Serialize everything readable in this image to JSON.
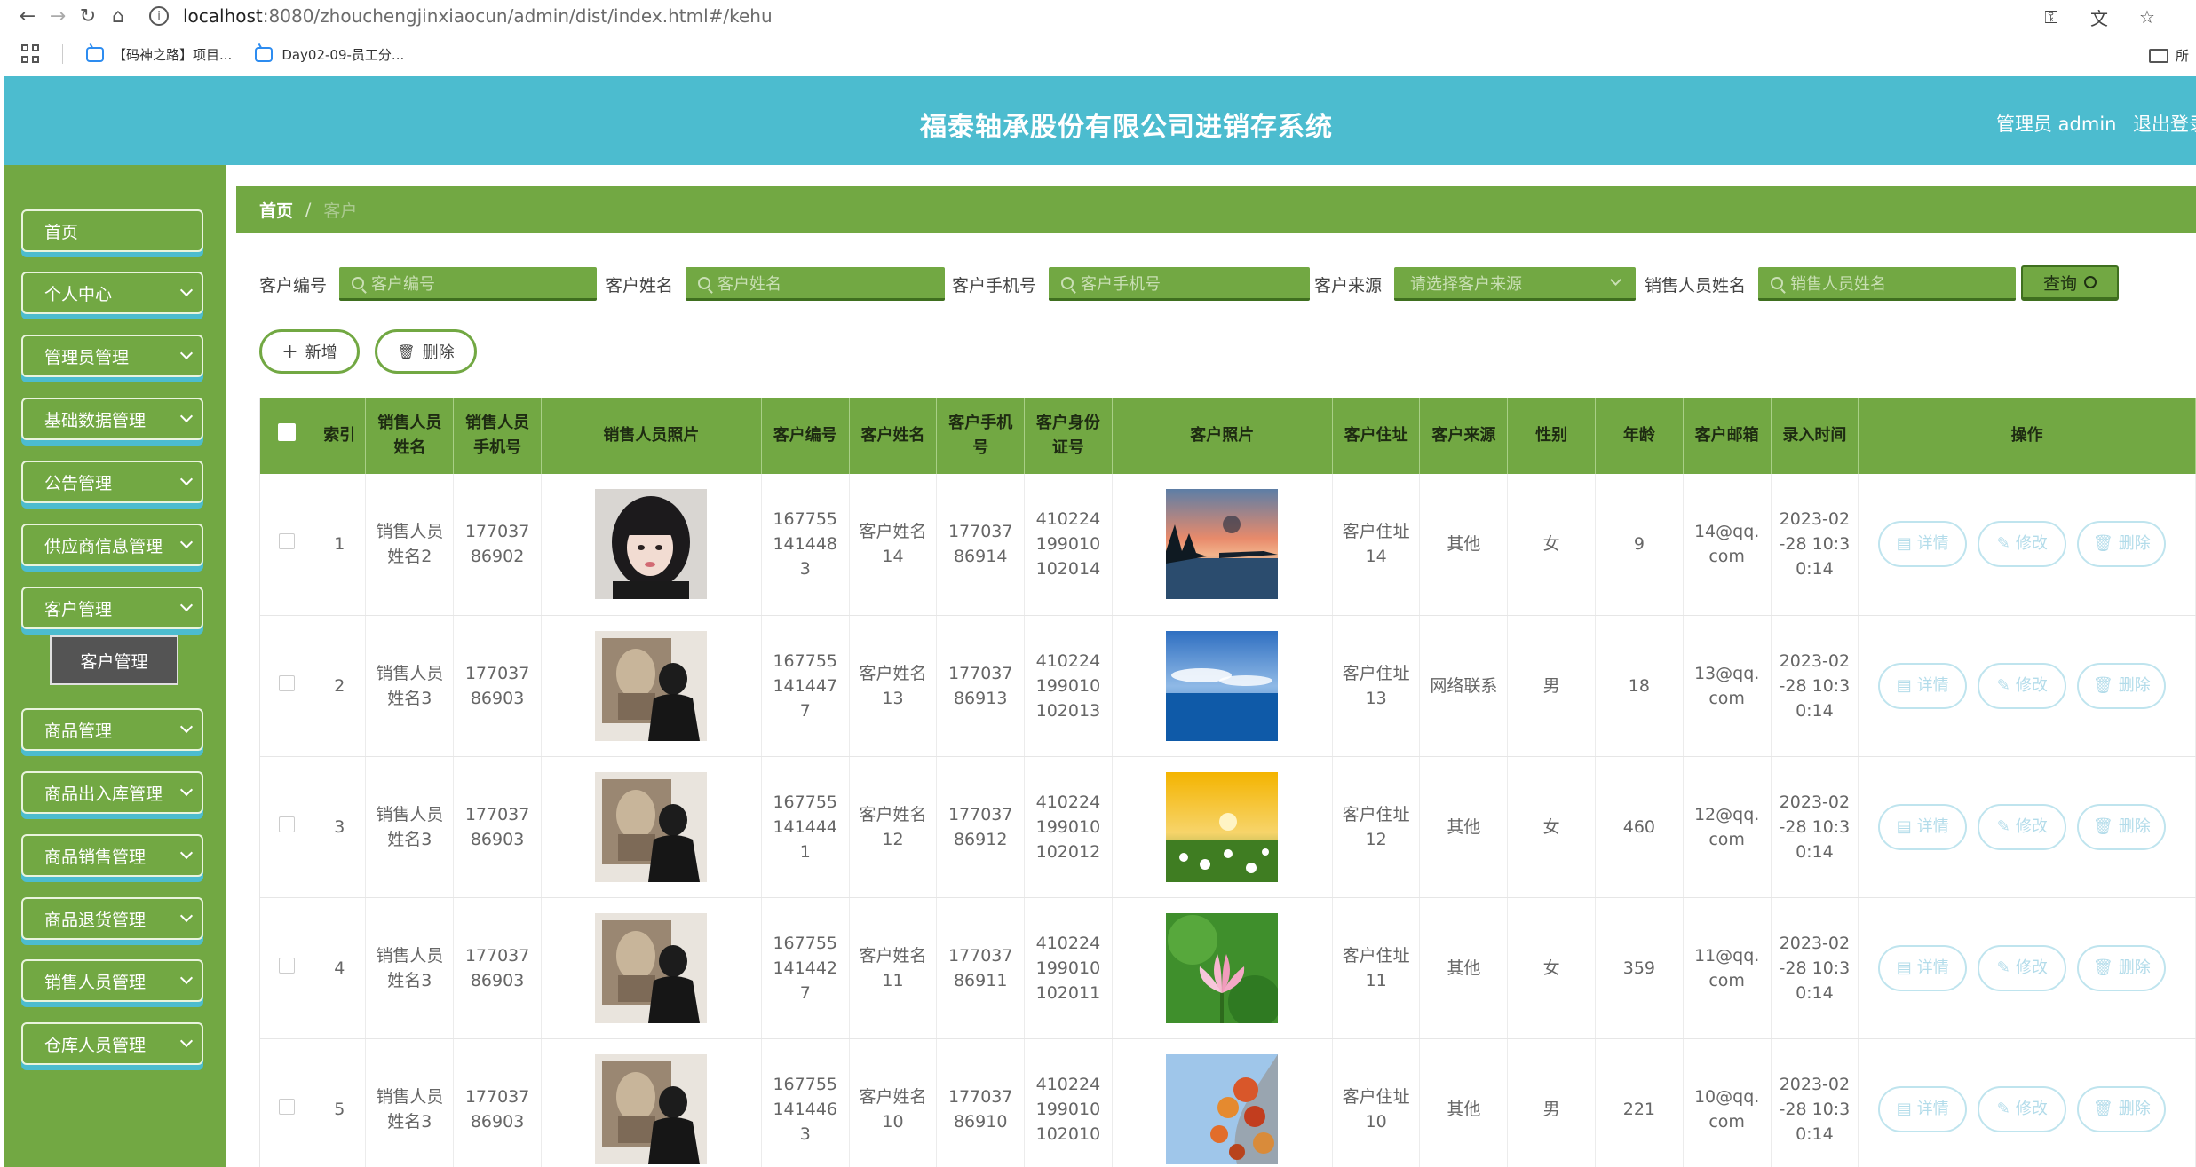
{
  "browser": {
    "host": "localhost",
    "url_path": ":8080/zhouchengjinxiaocun/admin/dist/index.html#/kehu",
    "bookmarks": [
      "【码神之路】项目...",
      "Day02-09-员工分..."
    ],
    "bookmarks_right": "所"
  },
  "header": {
    "title": "福泰轴承股份有限公司进销存系统",
    "user": "管理员 admin",
    "logout": "退出登录"
  },
  "sidebar": {
    "items": [
      {
        "label": "首页",
        "has_children": false
      },
      {
        "label": "个人中心",
        "has_children": true
      },
      {
        "label": "管理员管理",
        "has_children": true
      },
      {
        "label": "基础数据管理",
        "has_children": true
      },
      {
        "label": "公告管理",
        "has_children": true
      },
      {
        "label": "供应商信息管理",
        "has_children": true
      },
      {
        "label": "客户管理",
        "has_children": true
      },
      {
        "label": "商品管理",
        "has_children": true
      },
      {
        "label": "商品出入库管理",
        "has_children": true
      },
      {
        "label": "商品销售管理",
        "has_children": true
      },
      {
        "label": "商品退货管理",
        "has_children": true
      },
      {
        "label": "销售人员管理",
        "has_children": true
      },
      {
        "label": "仓库人员管理",
        "has_children": true
      }
    ],
    "active_sub": "客户管理"
  },
  "breadcrumb": {
    "home": "首页",
    "sep": "/",
    "current": "客户"
  },
  "filters": {
    "code_label": "客户编号",
    "code_placeholder": "客户编号",
    "name_label": "客户姓名",
    "name_placeholder": "客户姓名",
    "phone_label": "客户手机号",
    "phone_placeholder": "客户手机号",
    "source_label": "客户来源",
    "source_placeholder": "请选择客户来源",
    "sales_label": "销售人员姓名",
    "sales_placeholder": "销售人员姓名",
    "query": "查询"
  },
  "actions": {
    "add": "新增",
    "delete": "删除"
  },
  "table": {
    "columns": [
      "索引",
      "销售人员姓名",
      "销售人员手机号",
      "销售人员照片",
      "客户编号",
      "客户姓名",
      "客户手机号",
      "客户身份证号",
      "客户照片",
      "客户住址",
      "客户来源",
      "性别",
      "年龄",
      "客户邮箱",
      "录入时间",
      "操作"
    ],
    "row_buttons": {
      "detail": "详情",
      "edit": "修改",
      "delete": "删除"
    },
    "rows": [
      {
        "index": "1",
        "sales_name": "销售人员姓名2",
        "sales_phone": "17703786902",
        "sales_photo": "portrait-girl",
        "code": "1677551414483",
        "name": "客户姓名14",
        "phone": "17703786914",
        "id_card": "410224199010102014",
        "photo": "sunset-lake",
        "address": "客户住址14",
        "source": "其他",
        "gender": "女",
        "age": "9",
        "email": "14@qq.com",
        "time": "2023-02-28 10:30:14"
      },
      {
        "index": "2",
        "sales_name": "销售人员姓名3",
        "sales_phone": "17703786903",
        "sales_photo": "man-painting",
        "code": "1677551414477",
        "name": "客户姓名13",
        "phone": "17703786913",
        "id_card": "410224199010102013",
        "photo": "sea-sky",
        "address": "客户住址13",
        "source": "网络联系",
        "gender": "男",
        "age": "18",
        "email": "13@qq.com",
        "time": "2023-02-28 10:30:14"
      },
      {
        "index": "3",
        "sales_name": "销售人员姓名3",
        "sales_phone": "17703786903",
        "sales_photo": "man-painting",
        "code": "1677551414441",
        "name": "客户姓名12",
        "phone": "17703786912",
        "id_card": "410224199010102012",
        "photo": "flower-field",
        "address": "客户住址12",
        "source": "其他",
        "gender": "女",
        "age": "460",
        "email": "12@qq.com",
        "time": "2023-02-28 10:30:14"
      },
      {
        "index": "4",
        "sales_name": "销售人员姓名3",
        "sales_phone": "17703786903",
        "sales_photo": "man-painting",
        "code": "1677551414427",
        "name": "客户姓名11",
        "phone": "17703786911",
        "id_card": "410224199010102011",
        "photo": "lotus",
        "address": "客户住址11",
        "source": "其他",
        "gender": "女",
        "age": "359",
        "email": "11@qq.com",
        "time": "2023-02-28 10:30:14"
      },
      {
        "index": "5",
        "sales_name": "销售人员姓名3",
        "sales_phone": "17703786903",
        "sales_photo": "man-painting",
        "code": "1677551414463",
        "name": "客户姓名10",
        "phone": "17703786910",
        "id_card": "410224199010102010",
        "photo": "autumn-leaves",
        "address": "客户住址10",
        "source": "其他",
        "gender": "男",
        "age": "221",
        "email": "10@qq.com",
        "time": "2023-02-28 10:30:14"
      }
    ]
  },
  "colors": {
    "header": "#4cbccf",
    "primary_green": "#72a843",
    "op_button_border": "#bfe4ee"
  }
}
